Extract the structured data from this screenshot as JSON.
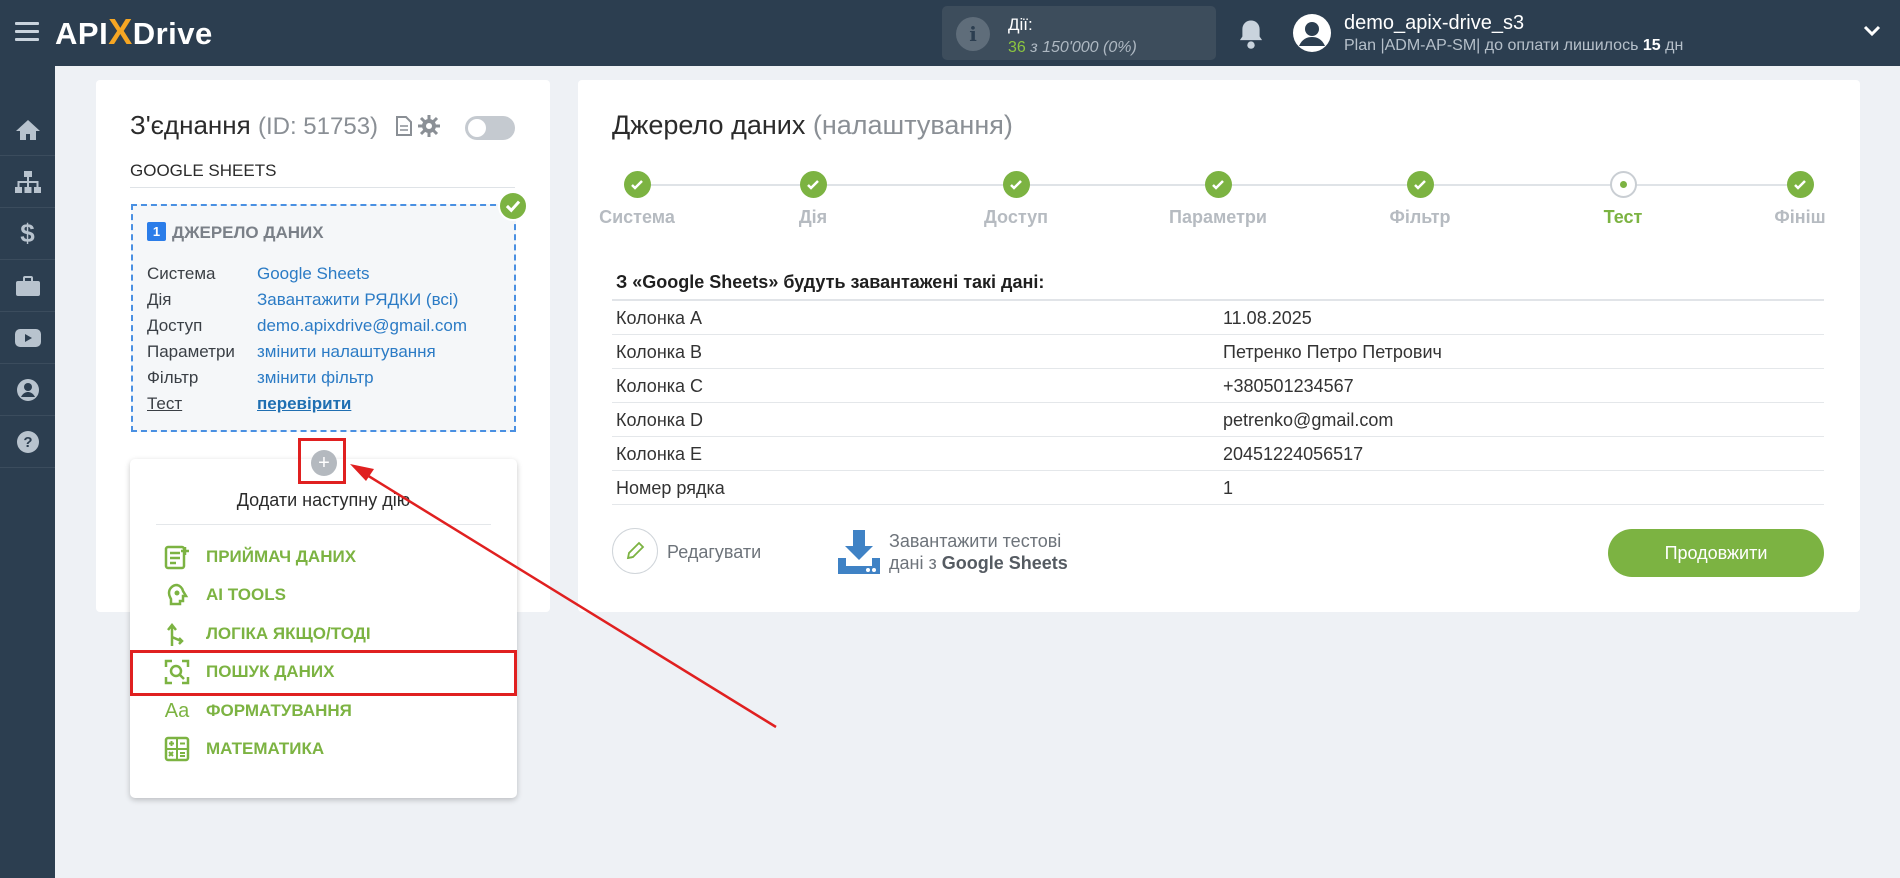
{
  "header": {
    "logo_prefix": "API",
    "logo_x": "X",
    "logo_suffix": "Drive",
    "actions_label": "Дії:",
    "actions_used": "36",
    "actions_rest": " з 150'000 (0%)",
    "user_name": "demo_apix-drive_s3",
    "plan_text": "Plan |ADM-AP-SM| до оплати лишилось ",
    "plan_days": "15",
    "plan_days_unit": " дн"
  },
  "sidebar": {
    "icons": [
      "home-icon",
      "sitemap-icon",
      "dollar-icon",
      "briefcase-icon",
      "youtube-icon",
      "user-icon",
      "help-icon"
    ]
  },
  "connection": {
    "title": "З'єднання",
    "id_text": "(ID: 51753)",
    "name": "GOOGLE SHEETS",
    "source": {
      "number": "1",
      "heading": "ДЖЕРЕЛО ДАНИХ",
      "rows": [
        {
          "key": "Система",
          "value": "Google Sheets"
        },
        {
          "key": "Дія",
          "value": "Завантажити РЯДКИ (всі)"
        },
        {
          "key": "Доступ",
          "value": "demo.apixdrive@gmail.com"
        },
        {
          "key": "Параметри",
          "value": "змінити налаштування"
        },
        {
          "key": "Фільтр",
          "value": "змінити фільтр"
        },
        {
          "key": "Тест",
          "value": "перевірити"
        }
      ]
    },
    "plus": "+"
  },
  "add_action": {
    "title": "Додати наступну дію",
    "items": [
      {
        "label": "ПРИЙМАЧ ДАНИХ",
        "icon": "receiver-icon"
      },
      {
        "label": "AI TOOLS",
        "icon": "ai-tools-icon"
      },
      {
        "label": "ЛОГІКА ЯКЩО/ТОДІ",
        "icon": "logic-icon"
      },
      {
        "label": "ПОШУК ДАНИХ",
        "icon": "search-data-icon"
      },
      {
        "label": "ФОРМАТУВАННЯ",
        "icon": "formatting-icon"
      },
      {
        "label": "МАТЕМАТИКА",
        "icon": "math-icon"
      }
    ],
    "format_glyph": "Aa"
  },
  "source_settings": {
    "title": "Джерело даних",
    "subtitle": "(налаштування)",
    "steps": [
      "Система",
      "Дія",
      "Доступ",
      "Параметри",
      "Фільтр",
      "Тест",
      "Фініш"
    ],
    "current_step": "Тест",
    "data_heading": "З «Google Sheets» будуть завантажені такі дані:",
    "rows": [
      {
        "key": "Колонка A",
        "value": "11.08.2025"
      },
      {
        "key": "Колонка B",
        "value": "Петренко Петро Петрович"
      },
      {
        "key": "Колонка C",
        "value": "+380501234567"
      },
      {
        "key": "Колонка D",
        "value": "petrenko@gmail.com"
      },
      {
        "key": "Колонка E",
        "value": "20451224056517"
      },
      {
        "key": "Номер рядка",
        "value": "1"
      }
    ],
    "edit_label": "Редагувати",
    "download_line1": "Завантажити тестові",
    "download_line2_prefix": "дані з ",
    "download_line2_bold": "Google Sheets",
    "continue_label": "Продовжити"
  },
  "colors": {
    "topbar": "#2c3e50",
    "accent_green": "#7cb342",
    "link_blue": "#2b7bc5",
    "highlight_red": "#e02020"
  }
}
